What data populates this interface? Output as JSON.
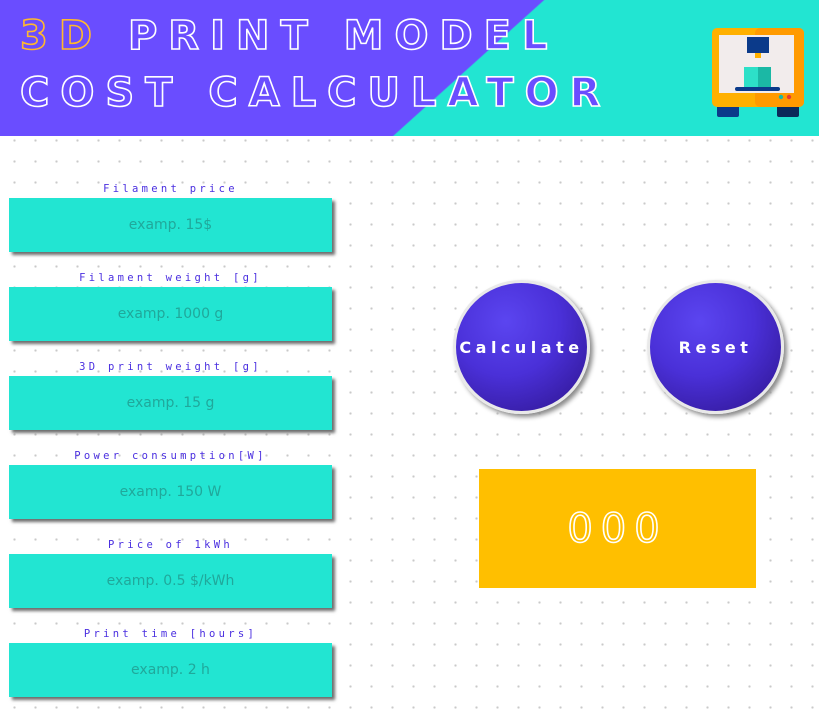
{
  "header": {
    "title_accent": "3D",
    "title_rest": " print model cost calculator"
  },
  "fields": [
    {
      "label": "Filament price",
      "placeholder": "examp. 15$"
    },
    {
      "label": "Filament weight [g]",
      "placeholder": "examp. 1000 g"
    },
    {
      "label": "3D print weight [g]",
      "placeholder": "examp. 15 g"
    },
    {
      "label": "Power consumption[W]",
      "placeholder": "examp. 150 W"
    },
    {
      "label": "Price of 1kWh",
      "placeholder": "examp. 0.5 $/kWh"
    },
    {
      "label": "Print time [hours]",
      "placeholder": "examp. 2 h"
    }
  ],
  "buttons": {
    "calculate": "Calculate",
    "reset": "Reset"
  },
  "result": {
    "value": "000"
  },
  "icons": {
    "header_icon": "3d-printer-icon"
  },
  "colors": {
    "primary": "#6a4dff",
    "accent_teal": "#22e5d2",
    "result_yellow": "#ffbf00",
    "label_text": "#4a2fe0"
  }
}
